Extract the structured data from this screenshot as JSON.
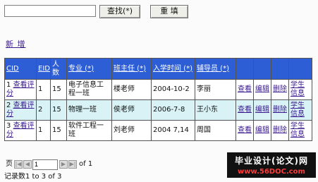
{
  "search": {
    "input_value": "",
    "search_button": "查找(*)",
    "reset_button": "重 填"
  },
  "add_link": "新 增",
  "table": {
    "headers": [
      "CID",
      "EID",
      "人数",
      "专业 (*)",
      "班主任 (*)",
      "入学时间 (*)",
      "辅导员 (*)",
      "",
      "",
      "",
      ""
    ],
    "rows": [
      {
        "cid": "1",
        "cid_link": "查看评分",
        "eid": "1",
        "count": "15",
        "major": "电子信息工程一班",
        "head_teacher": "楼老师",
        "date": "2004-10-2",
        "counselor": "李丽",
        "view": "查看",
        "edit": "编辑",
        "delete": "删除",
        "student_info": "学生信息"
      },
      {
        "cid": "2",
        "cid_link": "查看评分",
        "eid": "2",
        "count": "15",
        "major": "物理一班",
        "head_teacher": "侯老师",
        "date": "2006-7-8",
        "counselor": "王小东",
        "view": "查看",
        "edit": "编辑",
        "delete": "删除",
        "student_info": "学生信息"
      },
      {
        "cid": "3",
        "cid_link": "查看评分",
        "eid": "1",
        "count": "15",
        "major": "软件工程一班",
        "head_teacher": "刘老师",
        "date": "2004 7,14",
        "counselor": "周国",
        "view": "查看",
        "edit": "编辑",
        "delete": "删除",
        "student_info": "学生信息"
      }
    ]
  },
  "pager": {
    "label": "页",
    "current": "1",
    "of_text": "of 1",
    "records": "记录数1 to 3 of 3"
  },
  "watermark": {
    "line1": "毕业设计(论文)网",
    "line2": "www.56DOC.com"
  },
  "colors": {
    "header_bg": "#2d5ed6",
    "alt_row_bg": "#d8f2f6",
    "link": "#3b1b8f"
  }
}
